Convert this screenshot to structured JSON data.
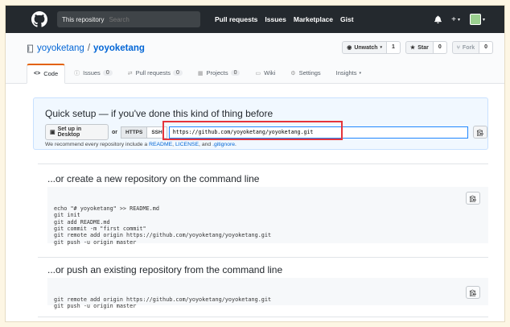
{
  "header": {
    "search_scope": "This repository",
    "search_placeholder": "Search",
    "nav": [
      "Pull requests",
      "Issues",
      "Marketplace",
      "Gist"
    ],
    "plus_label": "+"
  },
  "repo": {
    "owner": "yoyoketang",
    "separator": "/",
    "name": "yoyoketang",
    "watch": {
      "label": "Unwatch",
      "count": "1"
    },
    "star": {
      "label": "Star",
      "count": "0"
    },
    "fork": {
      "label": "Fork",
      "count": "0"
    }
  },
  "tabs": [
    {
      "label": "Code",
      "icon": "<>"
    },
    {
      "label": "Issues",
      "count": "0"
    },
    {
      "label": "Pull requests",
      "count": "0"
    },
    {
      "label": "Projects",
      "count": "0"
    },
    {
      "label": "Wiki"
    },
    {
      "label": "Settings"
    },
    {
      "label": "Insights"
    }
  ],
  "quick_setup": {
    "title": "Quick setup — if you've done this kind of thing before",
    "desktop_button": "Set up in Desktop",
    "or": "or",
    "https": "HTTPS",
    "ssh": "SSH",
    "url": "https://github.com/yoyoketang/yoyoketang.git",
    "recommend_prefix": "We recommend every repository include a",
    "readme": "README",
    "license": "LICENSE",
    "gitignore": ".gitignore",
    "and": "and",
    "comma": ",",
    "period": "."
  },
  "create_section": {
    "title": "...or create a new repository on the command line",
    "code": "echo \"# yoyoketang\" >> README.md\ngit init\ngit add README.md\ngit commit -m \"first commit\"\ngit remote add origin https://github.com/yoyoketang/yoyoketang.git\ngit push -u origin master"
  },
  "push_section": {
    "title": "...or push an existing repository from the command line",
    "code": "git remote add origin https://github.com/yoyoketang/yoyoketang.git\ngit push -u origin master"
  }
}
